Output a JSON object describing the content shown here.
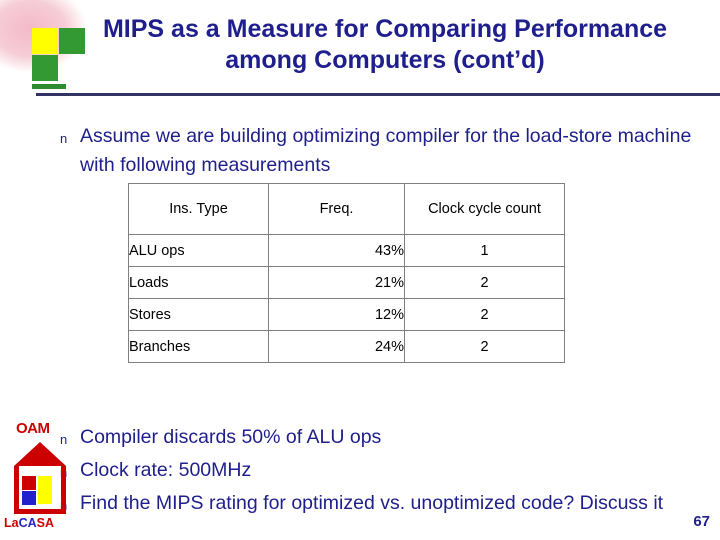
{
  "slide": {
    "title": "MIPS as a Measure for Comparing Performance among Computers (cont’d)",
    "page_number": "67"
  },
  "bullets": [
    {
      "marker": "n",
      "text": "Assume we are building optimizing compiler for the load-store machine with following measurements"
    },
    {
      "marker": "n",
      "text": "Compiler discards 50% of ALU ops"
    },
    {
      "marker": "n",
      "text": "Clock rate: 500MHz"
    },
    {
      "marker": "n",
      "text": "Find the MIPS rating for optimized vs. unoptimized code? Discuss it"
    }
  ],
  "table": {
    "headers": [
      "Ins. Type",
      "Freq.",
      "Clock cycle count"
    ],
    "rows": [
      {
        "type": "ALU ops",
        "freq": "43%",
        "count": "1"
      },
      {
        "type": "Loads",
        "freq": "21%",
        "count": "2"
      },
      {
        "type": "Stores",
        "freq": "12%",
        "count": "2"
      },
      {
        "type": "Branches",
        "freq": "24%",
        "count": "2"
      }
    ]
  },
  "logo": {
    "top_text": "OAM",
    "name_la": "La",
    "name_ca": "CA",
    "name_sa": "SA"
  },
  "colors": {
    "title_blue": "#1E1E8C",
    "rule": "#333366",
    "logo_red": "#CC0000",
    "logo_blue": "#2222CC",
    "logo_yellow": "#FFFF00",
    "deco_green": "#339933",
    "deco_yellow": "#FFFF00"
  }
}
